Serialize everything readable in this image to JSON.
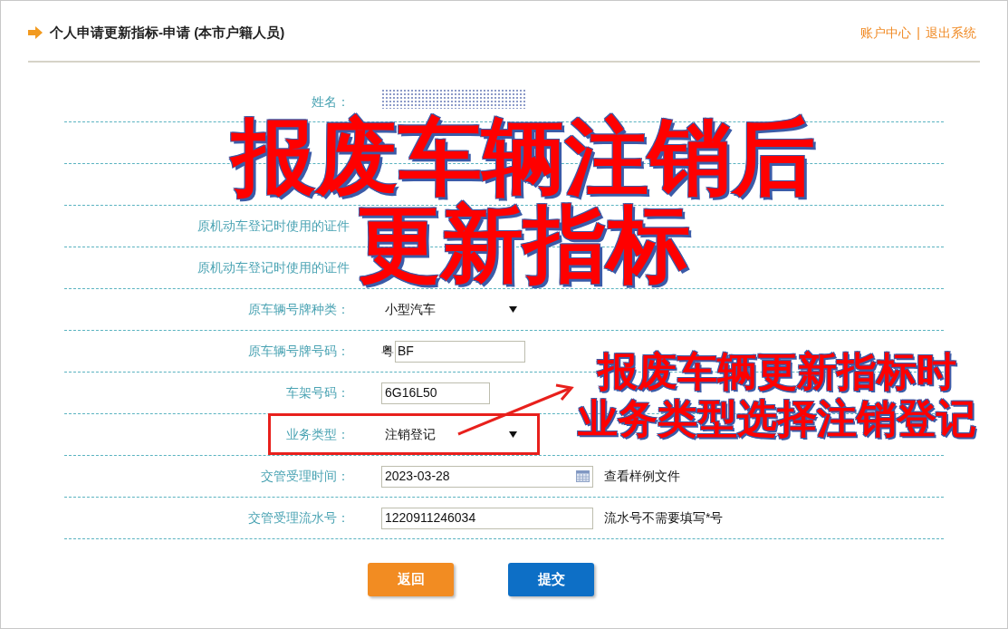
{
  "header": {
    "title": "个人申请更新指标-申请 (本市户籍人员)",
    "links": [
      "账户中心",
      "退出系统"
    ],
    "separator": "|"
  },
  "fields": [
    {
      "label": "姓名：",
      "kind": "redacted"
    },
    {
      "kind": "none"
    },
    {
      "kind": "none"
    },
    {
      "label": "原机动车登记时使用的证件",
      "kind": "none"
    },
    {
      "label": "原机动车登记时使用的证件",
      "kind": "none"
    },
    {
      "label": "原车辆号牌种类：",
      "kind": "select",
      "value": "小型汽车",
      "highlighted": false
    },
    {
      "label": "原车辆号牌号码：",
      "kind": "plate",
      "prefix": "粤",
      "value": "BF"
    },
    {
      "label": "车架号码：",
      "kind": "vin",
      "value_start": "6G1",
      "value_end": "6L50"
    },
    {
      "label": "业务类型：",
      "kind": "select",
      "value": "注销登记",
      "highlighted": true
    },
    {
      "label": "交管受理时间：",
      "kind": "date",
      "value": "2023-03-28",
      "note": "查看样例文件"
    },
    {
      "label": "交管受理流水号：",
      "kind": "input",
      "value": "1220911246034",
      "note": "流水号不需要填写*号"
    }
  ],
  "buttons": [
    {
      "label": "返回",
      "kind": "secondary"
    },
    {
      "label": "提交",
      "kind": "primary"
    }
  ],
  "annotations": [
    {
      "lines": [
        "报废车辆注销后",
        "更新指标"
      ],
      "kind": "headline"
    },
    {
      "lines": [
        "报废车辆更新指标时",
        "业务类型选择注销登记"
      ],
      "kind": "callout"
    }
  ]
}
